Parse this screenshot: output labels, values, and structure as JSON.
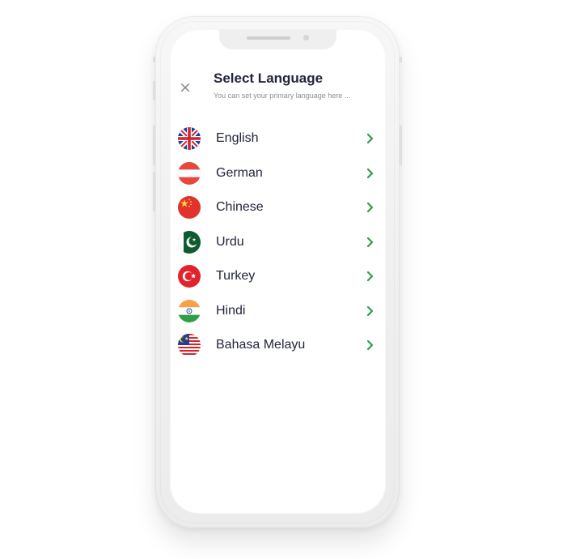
{
  "header": {
    "title": "Select Language",
    "subtitle": "You can set your primary language here ...",
    "close_icon": "×"
  },
  "languages": [
    {
      "label": "English",
      "flag_icon": "uk-flag-icon"
    },
    {
      "label": "German",
      "flag_icon": "austria-flag-icon"
    },
    {
      "label": "Chinese",
      "flag_icon": "china-flag-icon"
    },
    {
      "label": "Urdu",
      "flag_icon": "pakistan-flag-icon"
    },
    {
      "label": "Turkey",
      "flag_icon": "turkey-flag-icon"
    },
    {
      "label": "Hindi",
      "flag_icon": "india-flag-icon"
    },
    {
      "label": "Bahasa Melayu",
      "flag_icon": "malaysia-flag-icon"
    }
  ],
  "colors": {
    "title": "#22253c",
    "subtitle": "#8a8d97",
    "chevron": "#2e9f47"
  }
}
